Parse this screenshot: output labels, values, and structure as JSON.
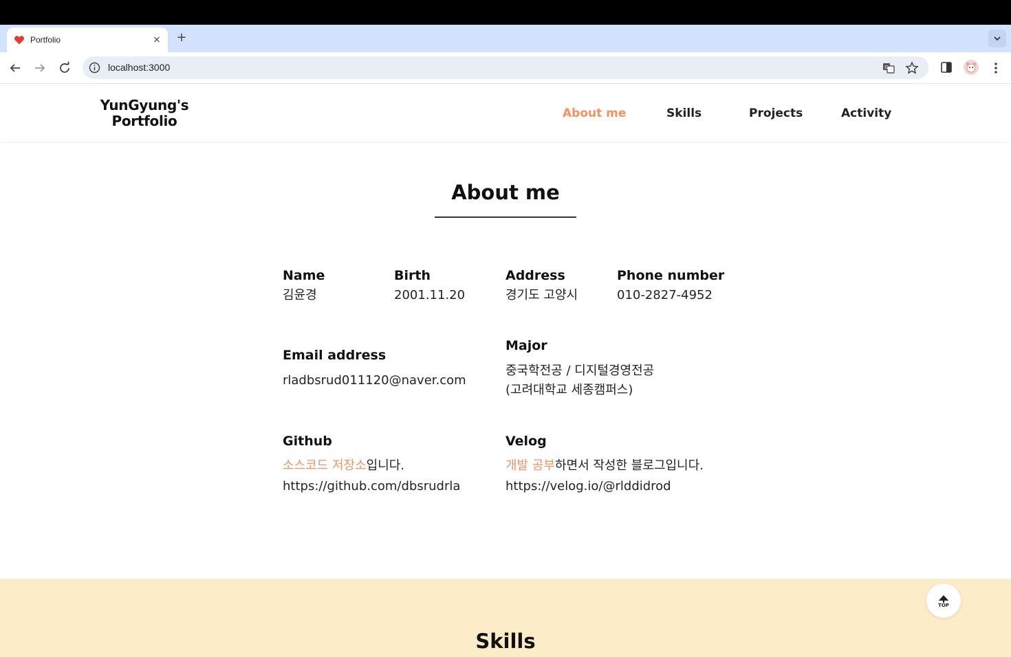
{
  "browser": {
    "tab_title": "Portfolio",
    "tab_close": "×",
    "new_tab": "+",
    "url": "localhost:3000"
  },
  "site": {
    "logo_line1": "YunGyung's",
    "logo_line2": "Portfolio",
    "nav": [
      {
        "label": "About me",
        "active": true
      },
      {
        "label": "Skills",
        "active": false
      },
      {
        "label": "Projects",
        "active": false
      },
      {
        "label": "Activity",
        "active": false
      }
    ],
    "accent_color": "#f5915d"
  },
  "about": {
    "title": "About me",
    "name": {
      "label": "Name",
      "value": "김윤경"
    },
    "birth": {
      "label": "Birth",
      "value": "2001.11.20"
    },
    "address": {
      "label": "Address",
      "value": "경기도 고양시"
    },
    "phone": {
      "label": "Phone number",
      "value": "010-2827-4952"
    },
    "email": {
      "label": "Email address",
      "value": "rladbsrud011120@naver.com"
    },
    "major": {
      "label": "Major",
      "line1": "중국학전공 / 디지털경영전공",
      "line2": "(고려대학교 세종캠퍼스)"
    },
    "github": {
      "label": "Github",
      "highlight": "소스코드 저장소",
      "suffix": "입니다.",
      "url": "https://github.com/dbsrudrla"
    },
    "velog": {
      "label": "Velog",
      "highlight": "개발 공부",
      "suffix": "하면서 작성한 블로그입니다.",
      "url": "https://velog.io/@rlddidrod"
    }
  },
  "skills": {
    "title": "Skills",
    "background": "#fdecc8"
  },
  "top_button": {
    "label": "TOP"
  }
}
